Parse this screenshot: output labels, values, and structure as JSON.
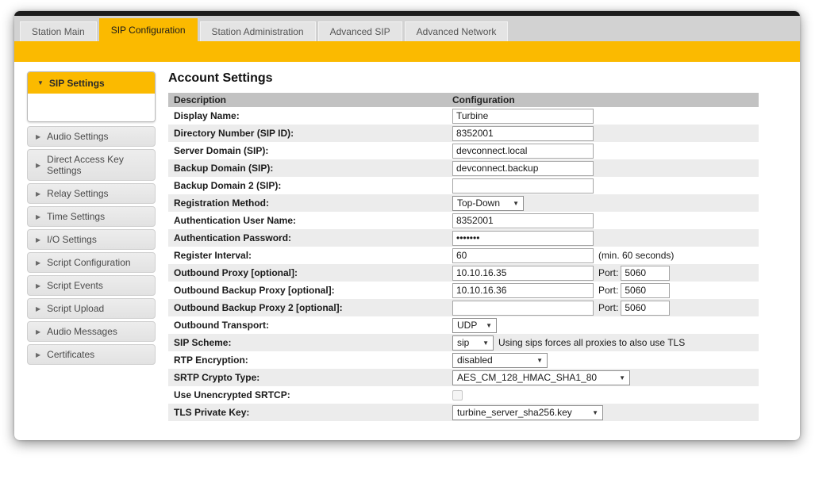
{
  "tabs": [
    {
      "label": "Station Main",
      "active": false
    },
    {
      "label": "SIP Configuration",
      "active": true
    },
    {
      "label": "Station Administration",
      "active": false
    },
    {
      "label": "Advanced SIP",
      "active": false
    },
    {
      "label": "Advanced Network",
      "active": false
    }
  ],
  "sidebar": {
    "expanded_group": {
      "label": "SIP Settings"
    },
    "items": [
      {
        "label": "Audio Settings"
      },
      {
        "label": "Direct Access Key Settings"
      },
      {
        "label": "Relay Settings"
      },
      {
        "label": "Time Settings"
      },
      {
        "label": "I/O Settings"
      },
      {
        "label": "Script Configuration"
      },
      {
        "label": "Script Events"
      },
      {
        "label": "Script Upload"
      },
      {
        "label": "Audio Messages"
      },
      {
        "label": "Certificates"
      }
    ]
  },
  "main": {
    "title": "Account Settings",
    "table": {
      "header_description": "Description",
      "header_configuration": "Configuration",
      "rows": [
        {
          "label": "Display Name:",
          "value": "Turbine"
        },
        {
          "label": "Directory Number (SIP ID):",
          "value": "8352001"
        },
        {
          "label": "Server Domain (SIP):",
          "value": "devconnect.local"
        },
        {
          "label": "Backup Domain (SIP):",
          "value": "devconnect.backup"
        },
        {
          "label": "Backup Domain 2 (SIP):",
          "value": ""
        },
        {
          "label": "Registration Method:",
          "value": "Top-Down"
        },
        {
          "label": "Authentication User Name:",
          "value": "8352001"
        },
        {
          "label": "Authentication Password:",
          "value": "•••••••"
        },
        {
          "label": "Register Interval:",
          "value": "60",
          "note": "(min. 60 seconds)"
        },
        {
          "label": "Outbound Proxy [optional]:",
          "value": "10.10.16.35",
          "port_label": "Port:",
          "port_value": "5060"
        },
        {
          "label": "Outbound Backup Proxy [optional]:",
          "value": "10.10.16.36",
          "port_label": "Port:",
          "port_value": "5060"
        },
        {
          "label": "Outbound Backup Proxy 2 [optional]:",
          "value": "",
          "port_label": "Port:",
          "port_value": "5060"
        },
        {
          "label": "Outbound Transport:",
          "value": "UDP"
        },
        {
          "label": "SIP Scheme:",
          "value": "sip",
          "note": "Using sips forces all proxies to also use TLS"
        },
        {
          "label": "RTP Encryption:",
          "value": "disabled"
        },
        {
          "label": "SRTP Crypto Type:",
          "value": "AES_CM_128_HMAC_SHA1_80"
        },
        {
          "label": "Use Unencrypted SRTCP:",
          "checkbox_checked": false
        },
        {
          "label": "TLS Private Key:",
          "value": "turbine_server_sha256.key"
        }
      ]
    }
  },
  "colors": {
    "accent_yellow": "#fbba00",
    "top_bar_black": "#1c1c1c",
    "tabstrip_gray": "#d2d2d2",
    "table_header_gray": "#c2c2c2",
    "row_alt_gray": "#ececec"
  },
  "icons": {
    "expanded_arrow": "▼",
    "collapsed_arrow": "▶",
    "dropdown_arrow": "▼"
  }
}
